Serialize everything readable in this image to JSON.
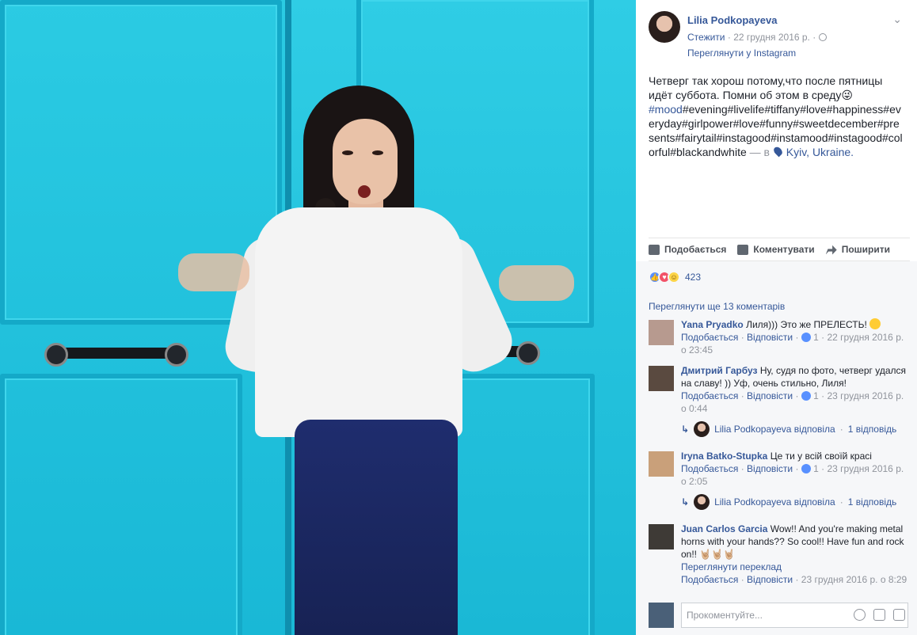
{
  "author": {
    "name": "Lilia Podkopayeva",
    "follow_label": "Стежити",
    "date": "22 грудня 2016 р.",
    "instagram_link": "Переглянути у Instagram"
  },
  "post": {
    "text": "Четверг так хорош потому,что после пятницы идёт суббота. Помни об этом в среду😜",
    "tag_first": "#mood",
    "tags_rest": "#evening#livelife#tiffany#love#happiness#everyday#girlpower#love#funny#sweetdecember#presents#fairytail#instagood#instamood#instagood#colorful#blackandwhite",
    "location_prefix": "— в",
    "location": "Kyiv, Ukraine."
  },
  "actions": {
    "like": "Подобається",
    "comment": "Коментувати",
    "share": "Поширити"
  },
  "reactions": {
    "count": "423"
  },
  "more_comments": "Переглянути ще 13 коментарів",
  "comments": [
    {
      "name": "Yana Pryadko",
      "text": "Лиля))) Это же ПРЕЛЕСТЬ!",
      "like": "Подобається",
      "reply": "Відповісти",
      "likes": "1",
      "time": "22 грудня 2016 р. о 23:45"
    },
    {
      "name": "Дмитрий Гарбуз",
      "text": "Ну, судя по фото, четверг удался на славу! )) Уф, очень стильно, Лиля!",
      "like": "Подобається",
      "reply": "Відповісти",
      "likes": "1",
      "time": "23 грудня 2016 р. о 0:44",
      "reply_author": "Lilia Podkopayeva відповіла",
      "reply_count": "1 відповідь"
    },
    {
      "name": "Iryna Batko-Stupka",
      "text": "Це ти у всій своїй красі",
      "like": "Подобається",
      "reply": "Відповісти",
      "likes": "1",
      "time": "23 грудня 2016 р. о 2:05",
      "reply_author": "Lilia Podkopayeva відповіла",
      "reply_count": "1 відповідь"
    },
    {
      "name": "Juan Carlos Garcia",
      "text": "Wow!! And you're making metal horns with your hands?? So cool!! Have fun and rock on!! 🤘🏼🤘🏼🤘🏼",
      "translate": "Переглянути переклад",
      "like": "Подобається",
      "reply": "Відповісти",
      "time": "23 грудня 2016 р. о 8:29"
    }
  ],
  "compose": {
    "placeholder": "Прокоментуйте..."
  },
  "colors": {
    "link": "#365899",
    "door": "#22c6e0"
  }
}
